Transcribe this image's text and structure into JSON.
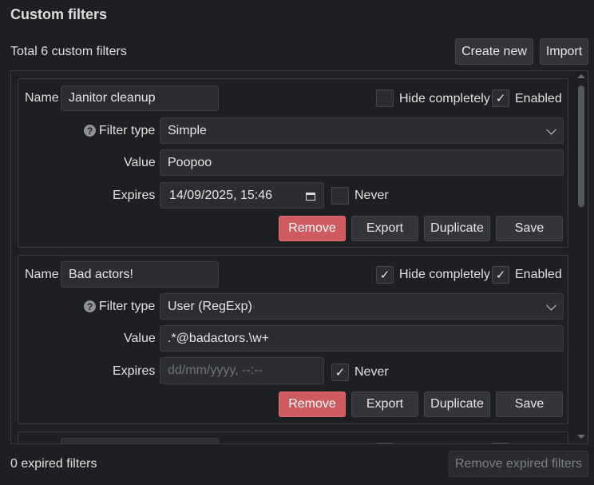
{
  "header": {
    "title": "Custom filters",
    "total": "Total 6 custom filters"
  },
  "toolbar": {
    "create_label": "Create new",
    "import_label": "Import"
  },
  "labels": {
    "name": "Name",
    "filter_type": "Filter type",
    "value": "Value",
    "expires": "Expires",
    "hide_completely": "Hide completely",
    "enabled": "Enabled",
    "never": "Never",
    "remove": "Remove",
    "export": "Export",
    "duplicate": "Duplicate",
    "save": "Save",
    "help_glyph": "?",
    "check_glyph": "✓"
  },
  "filters": [
    {
      "name": "Janitor cleanup",
      "hide_completely": false,
      "enabled": true,
      "filter_type": "Simple",
      "value": "Poopoo",
      "expires": "14/09/2025, 15:46",
      "never": false
    },
    {
      "name": "Bad actors!",
      "hide_completely": true,
      "enabled": true,
      "filter_type": "User (RegExp)",
      "value": ".*@badactors.\\w+",
      "expires_placeholder": "dd/mm/yyyy, --:--",
      "never": true
    }
  ],
  "footer": {
    "expired_count": "0 expired filters",
    "remove_expired_label": "Remove expired filters"
  },
  "colors": {
    "danger": "#cf5a5f",
    "background": "#1e1f22",
    "field": "#2b2d31"
  }
}
